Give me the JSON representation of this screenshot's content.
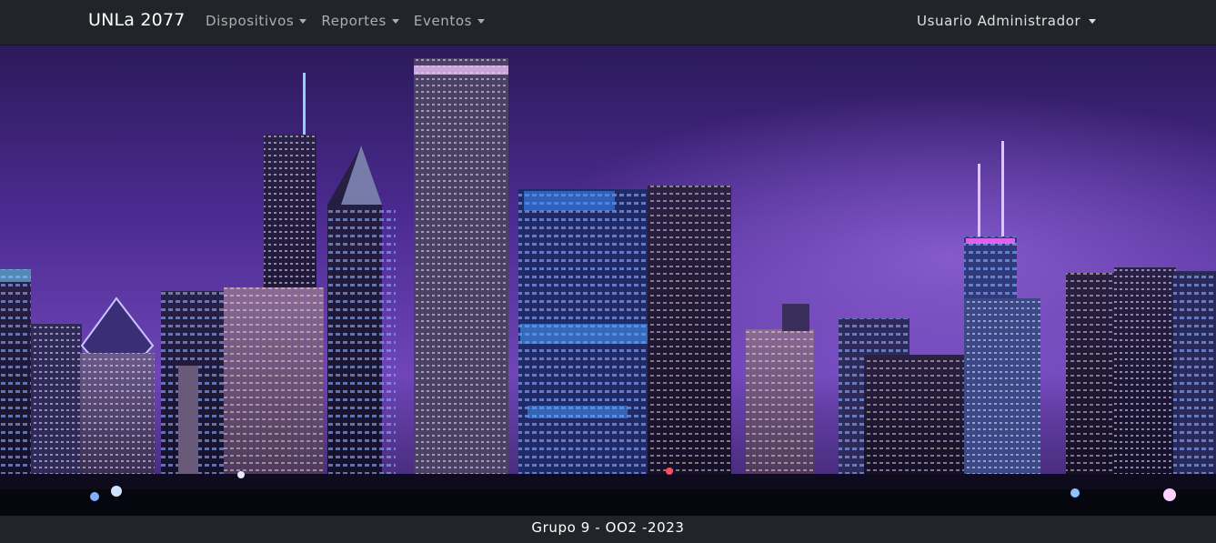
{
  "navbar": {
    "brand": "UNLa 2077",
    "menus": [
      {
        "label": "Dispositivos"
      },
      {
        "label": "Reportes"
      },
      {
        "label": "Eventos"
      }
    ],
    "user_menu_label": "Usuario Administrador"
  },
  "footer": {
    "text": "Grupo 9 - OO2 -2023"
  },
  "colors": {
    "navbar_bg": "#212529",
    "sky_top": "#3a2470",
    "sky_mid": "#6a3fb0",
    "accent_light": "#9d7bff"
  }
}
